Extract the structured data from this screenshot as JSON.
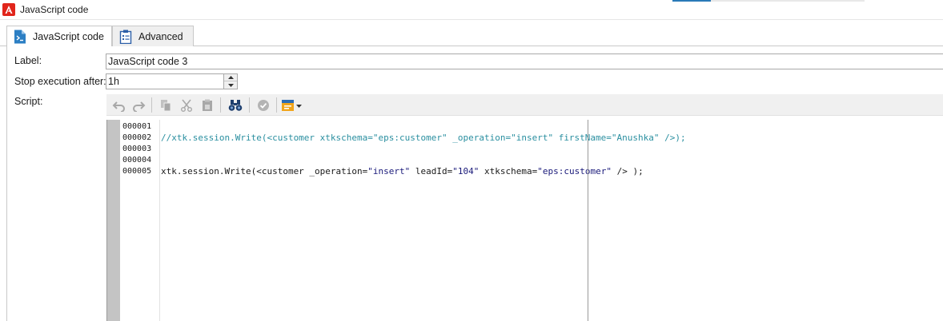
{
  "window": {
    "title": "JavaScript code",
    "logo_color": "#e1251b"
  },
  "tabs": [
    {
      "label": "JavaScript code",
      "icon": "javascript-file-icon",
      "active": true
    },
    {
      "label": "Advanced",
      "icon": "clipboard-icon",
      "active": false
    }
  ],
  "form": {
    "label_caption": "Label:",
    "label_value": "JavaScript code 3",
    "stop_caption": "Stop execution after:",
    "stop_value": "1h",
    "script_caption": "Script:"
  },
  "toolbar": {
    "buttons": [
      {
        "name": "undo",
        "icon": "undo-icon",
        "enabled": false
      },
      {
        "name": "redo",
        "icon": "redo-icon",
        "enabled": false
      },
      {
        "name": "copy",
        "icon": "copy-icon",
        "enabled": false
      },
      {
        "name": "cut",
        "icon": "cut-icon",
        "enabled": false
      },
      {
        "name": "paste",
        "icon": "paste-icon",
        "enabled": false
      },
      {
        "name": "find",
        "icon": "binoculars-icon",
        "enabled": true
      },
      {
        "name": "check-syntax",
        "icon": "checkmark-circle-icon",
        "enabled": false
      },
      {
        "name": "insert",
        "icon": "insert-field-icon",
        "enabled": true
      }
    ]
  },
  "editor": {
    "line_numbers": [
      "000001",
      "000002",
      "000003",
      "000004",
      "000005"
    ],
    "lines": [
      {
        "text": "",
        "kind": "plain"
      },
      {
        "text": "//xtk.session.Write(<customer xtkschema=\"eps:customer\" _operation=\"insert\" firstName=\"Anushka\" />);",
        "kind": "comment"
      },
      {
        "text": "",
        "kind": "plain"
      },
      {
        "text": "",
        "kind": "plain"
      },
      {
        "prefix": "xtk.session.Write(<customer _operation=",
        "s1": "\"insert\"",
        "mid1": " leadId=",
        "s2": "\"104\"",
        "mid2": " xtkschema=",
        "s3": "\"eps:customer\"",
        "suffix": " /> );",
        "kind": "mixed"
      }
    ],
    "colors": {
      "comment": "#2a8fa0",
      "string": "#1a1a7a",
      "plain": "#1a1a1a",
      "margin": "#c4c4c4"
    }
  }
}
